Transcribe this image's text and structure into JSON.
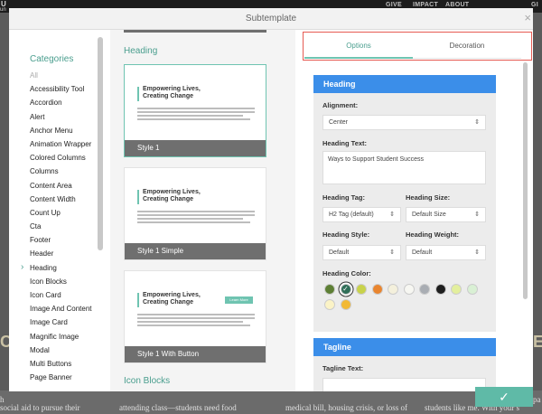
{
  "background": {
    "top_left": "U",
    "top_left_sub": "un",
    "nav": [
      "GIVE",
      "IMPACT",
      "ABOUT"
    ],
    "far_right": "GI",
    "big_left": "CH",
    "big_right": "E",
    "bottom_texts": [
      "h",
      "social aid to pursue their",
      "attending class—students need food",
      "medical bill, housing crisis, or loss of",
      "students like me. With your s"
    ],
    "side_text": "pa"
  },
  "modal": {
    "title": "Subtemplate",
    "close_label": "×"
  },
  "categories": {
    "title": "Categories",
    "items": [
      {
        "label": "All",
        "muted": true
      },
      {
        "label": "Accessibility Tool"
      },
      {
        "label": "Accordion"
      },
      {
        "label": "Alert"
      },
      {
        "label": "Anchor Menu"
      },
      {
        "label": "Animation Wrapper"
      },
      {
        "label": "Colored Columns"
      },
      {
        "label": "Columns"
      },
      {
        "label": "Content Area"
      },
      {
        "label": "Content Width"
      },
      {
        "label": "Count Up"
      },
      {
        "label": "Cta"
      },
      {
        "label": "Footer"
      },
      {
        "label": "Header"
      },
      {
        "label": "Heading",
        "active": true
      },
      {
        "label": "Icon Blocks"
      },
      {
        "label": "Icon Card"
      },
      {
        "label": "Image And Content"
      },
      {
        "label": "Image Card"
      },
      {
        "label": "Magnific Image"
      },
      {
        "label": "Modal"
      },
      {
        "label": "Multi Buttons"
      },
      {
        "label": "Page Banner"
      }
    ]
  },
  "templates": {
    "section_title": "Heading",
    "next_section_title": "Icon Blocks",
    "cards": [
      {
        "heading_line1": "Empowering Lives,",
        "heading_line2": "Creating Change",
        "caption": "Style 1",
        "selected": true
      },
      {
        "heading_line1": "Empowering Lives,",
        "heading_line2": "Creating Change",
        "caption": "Style 1 Simple"
      },
      {
        "heading_line1": "Empowering Lives,",
        "heading_line2": "Creating Change",
        "caption": "Style 1 With Button",
        "button": "Learn More"
      }
    ]
  },
  "settings": {
    "tabs": [
      {
        "label": "Options",
        "active": true
      },
      {
        "label": "Decoration"
      }
    ],
    "heading_panel": {
      "title": "Heading",
      "alignment_label": "Alignment:",
      "alignment_value": "Center",
      "heading_text_label": "Heading Text:",
      "heading_text_value": "Ways to Support Student Success",
      "heading_tag_label": "Heading Tag:",
      "heading_tag_value": "H2 Tag (default)",
      "heading_size_label": "Heading Size:",
      "heading_size_value": "Default Size",
      "heading_style_label": "Heading Style:",
      "heading_style_value": "Default",
      "heading_weight_label": "Heading Weight:",
      "heading_weight_value": "Default",
      "heading_color_label": "Heading Color:",
      "colors": [
        "#5d7f34",
        "#2f6e58",
        "#c8d24a",
        "#e9852f",
        "#f4f0dc",
        "#f7f7f2",
        "#a9adb3",
        "#1e1e1e",
        "#e3ef9d",
        "#d9f0d4",
        "#fbf3c6",
        "#f2b935"
      ],
      "selected_color": "#2f6e58"
    },
    "tagline_panel": {
      "title": "Tagline",
      "tagline_text_label": "Tagline Text:"
    }
  },
  "confirm": {
    "label": "✓"
  }
}
